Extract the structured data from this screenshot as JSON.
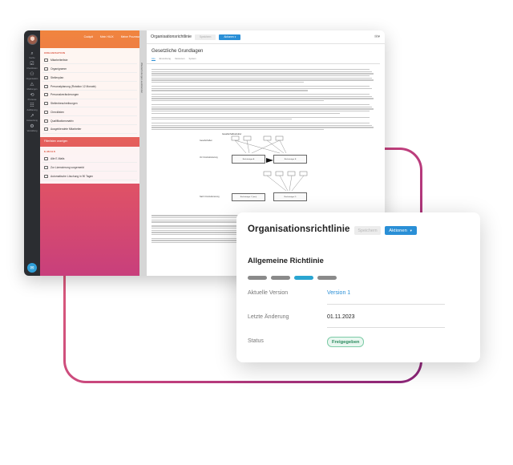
{
  "colors": {
    "accent_blue": "#2a8fd6",
    "step_active": "#2aa5d1",
    "badge_green": "#2b8a5e",
    "nav_orange": "#f0853e",
    "nav_pink": "#c83f7c"
  },
  "rail": {
    "items": [
      {
        "icon": "search-icon",
        "glyph": "⌕",
        "label": "Suche"
      },
      {
        "icon": "checklist-icon",
        "glyph": "☑",
        "label": "Checklisten"
      },
      {
        "icon": "organization-icon",
        "glyph": "⚇",
        "label": "Organisation"
      },
      {
        "icon": "warning-icon",
        "glyph": "⚠",
        "label": "Meldungen"
      },
      {
        "icon": "process-icon",
        "glyph": "⟲",
        "label": "Prozesse"
      },
      {
        "icon": "audit-icon",
        "glyph": "☷",
        "label": "Auditierung"
      },
      {
        "icon": "chart-icon",
        "glyph": "↗",
        "label": "Auswertung"
      },
      {
        "icon": "gear-icon",
        "glyph": "⚙",
        "label": "Verwaltung"
      }
    ]
  },
  "nav": {
    "top_links": [
      "Cockpit",
      "Mein HILIX",
      "Meine Prozesse"
    ],
    "section1_title": "ORGANISATION",
    "section1_items": [
      "Mitarbeiterliste",
      "Organigramm",
      "Stellenplan",
      "Personalplanung (Rotation 12 Monate)",
      "Personalveränderungen",
      "Stellenbeschreibungen",
      "Checklisten",
      "Qualifikationsmatrix",
      "Ausgeblendete Mitarbeiter"
    ],
    "section1_link": "Filterlisten anzeigen",
    "section2_title": "E-MAILS",
    "section2_items": [
      "Alle E-Mails",
      "Zur Lizenzierung vorgemerkt",
      "Automatische Löschung in 90 Tagen"
    ],
    "handle_label": "Wiederholungen ausblenden"
  },
  "doc": {
    "title": "Organisationsrichtlinie",
    "save_label": "Speichern",
    "actions_label": "Aktionen",
    "heading": "Gesetzliche Grundlagen",
    "tabs": [
      "Info",
      "Einordnung",
      "Versionen",
      "System"
    ],
    "diagram": {
      "title": "Gesellschaftsstruktur",
      "label_top": "Gesellschaften",
      "label_mid": "Vor Umstrukturierung",
      "label_bot": "Nach Umstrukturierung",
      "box_a": "Rechtsträger A",
      "box_b": "Rechtsträger B",
      "box_c": "Rechtsträger C (neu)",
      "box_d": "Rechtsträger D"
    }
  },
  "card": {
    "title": "Organisationsrichtlinie",
    "save_label": "Speichern",
    "actions_label": "Aktionen",
    "subtitle": "Allgemeine Richtlinie",
    "steps_active_index": 2,
    "rows": [
      {
        "label": "Aktuelle Version",
        "value": "Version 1"
      },
      {
        "label": "Letzte Änderung",
        "value": "01.11.2023"
      },
      {
        "label": "Status",
        "value": "Freigegeben"
      }
    ]
  }
}
